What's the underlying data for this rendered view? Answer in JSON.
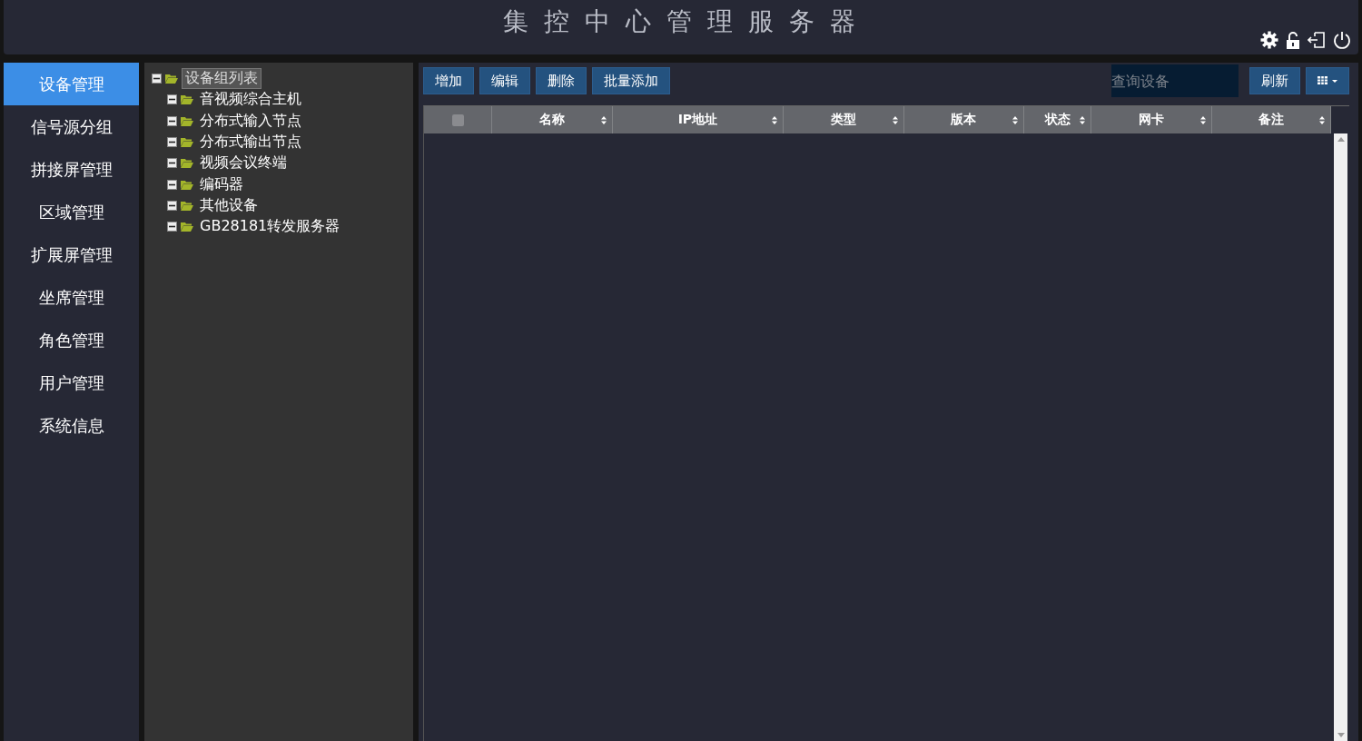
{
  "header": {
    "title": "集 控 中 心 管 理 服 务 器"
  },
  "sidebar": {
    "items": [
      {
        "label": "设备管理",
        "selected": true
      },
      {
        "label": "信号源分组",
        "selected": false
      },
      {
        "label": "拼接屏管理",
        "selected": false
      },
      {
        "label": "区域管理",
        "selected": false
      },
      {
        "label": "扩展屏管理",
        "selected": false
      },
      {
        "label": "坐席管理",
        "selected": false
      },
      {
        "label": "角色管理",
        "selected": false
      },
      {
        "label": "用户管理",
        "selected": false
      },
      {
        "label": "系统信息",
        "selected": false
      }
    ]
  },
  "tree": {
    "root": {
      "label": "设备组列表",
      "selected": true,
      "expanded": true,
      "children": [
        {
          "label": "音视频综合主机",
          "selected": false,
          "expanded": true
        },
        {
          "label": "分布式输入节点",
          "selected": false,
          "expanded": true
        },
        {
          "label": "分布式输出节点",
          "selected": false,
          "expanded": true
        },
        {
          "label": "视频会议终端",
          "selected": false,
          "expanded": true
        },
        {
          "label": "编码器",
          "selected": false,
          "expanded": true
        },
        {
          "label": "其他设备",
          "selected": false,
          "expanded": true
        },
        {
          "label": "GB28181转发服务器",
          "selected": false,
          "expanded": true
        }
      ]
    }
  },
  "toolbar": {
    "buttons": [
      "增加",
      "编辑",
      "删除",
      "批量添加"
    ],
    "search": {
      "placeholder": "查询设备"
    },
    "refresh": "刷新"
  },
  "table": {
    "select_all": {
      "checked": false
    },
    "columns": [
      "名称",
      "IP地址",
      "类型",
      "版本",
      "状态",
      "网卡",
      "备注"
    ]
  }
}
